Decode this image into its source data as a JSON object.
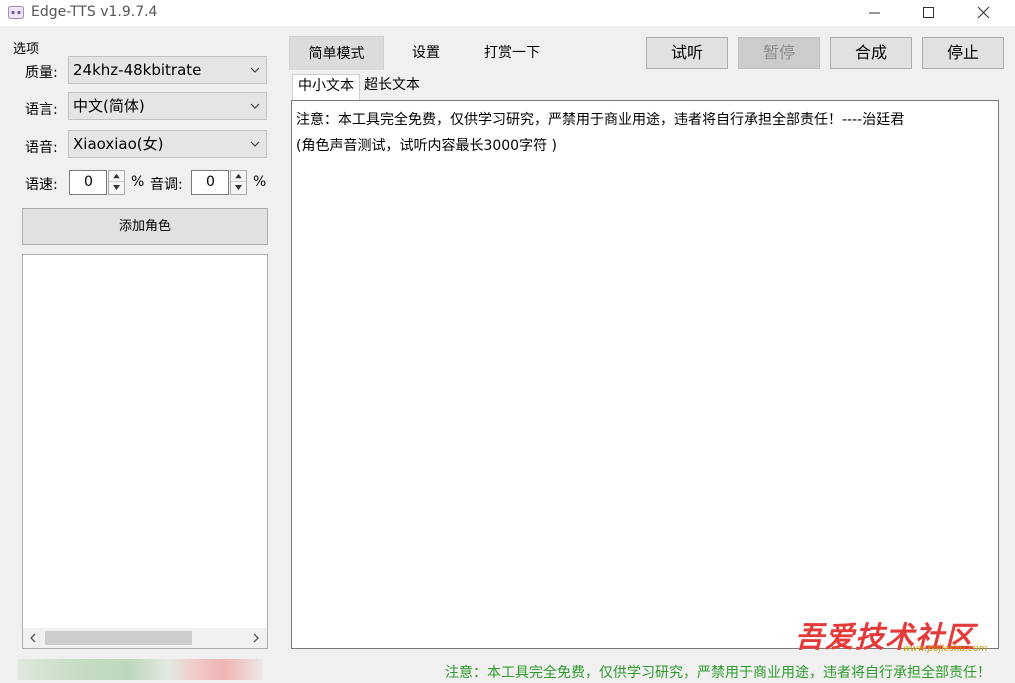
{
  "window": {
    "title": "Edge-TTS v1.9.7.4",
    "controls": {
      "minimize": "—",
      "maximize": "☐",
      "close": "✕"
    }
  },
  "options_panel": {
    "group_label": "选项",
    "quality": {
      "label": "质量:",
      "value": "24khz-48kbitrate"
    },
    "language": {
      "label": "语言:",
      "value": "中文(简体)"
    },
    "voice": {
      "label": "语音:",
      "value": "Xiaoxiao(女)"
    },
    "rate": {
      "label": "语速:",
      "value": "0",
      "unit": "%"
    },
    "pitch": {
      "label": "音调:",
      "value": "0",
      "unit": "%"
    },
    "add_role_label": "添加角色"
  },
  "main_tabs": [
    {
      "label": "简单模式",
      "active": true
    },
    {
      "label": "设置",
      "active": false
    },
    {
      "label": "打赏一下",
      "active": false
    }
  ],
  "actions": {
    "preview": "试听",
    "pause": "暂停",
    "synthesize": "合成",
    "stop": "停止"
  },
  "sub_tabs": [
    {
      "label": "中小文本",
      "active": true
    },
    {
      "label": "超长文本",
      "active": false
    }
  ],
  "editor": {
    "line1": "注意：本工具完全免费，仅供学习研究，严禁用于商业用途，违者将自行承担全部责任！----治廷君",
    "line2": "(角色声音测试，试听内容最长3000字符 )"
  },
  "watermark": {
    "text": "吾爱技术社区",
    "url": "www.pojieshu.com"
  },
  "status": "注意：本工具完全免费，仅供学习研究，严禁用于商业用途，违者将自行承担全部责任！",
  "colors": {
    "status_text": "#2e9a2e",
    "watermark": "#e53a3a",
    "disabled_button": "#cccccc"
  },
  "icons": [
    "app-icon",
    "chevron-down-icon",
    "spin-up-icon",
    "spin-down-icon",
    "scroll-left-icon",
    "scroll-right-icon"
  ]
}
